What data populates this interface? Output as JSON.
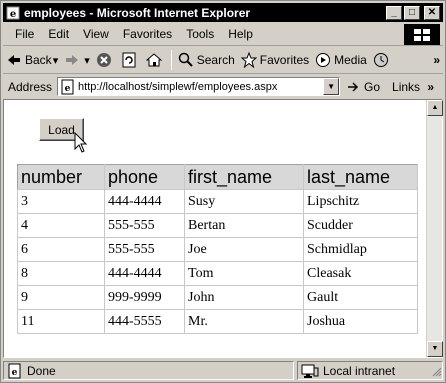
{
  "window": {
    "title": "employees - Microsoft Internet Explorer",
    "minimize_glyph": "_",
    "maximize_glyph": "□",
    "close_glyph": "✕"
  },
  "menu": [
    "File",
    "Edit",
    "View",
    "Favorites",
    "Tools",
    "Help"
  ],
  "toolbar": {
    "back_label": "Back",
    "search_label": "Search",
    "favorites_label": "Favorites",
    "media_label": "Media",
    "more_glyph": "»"
  },
  "address": {
    "label": "Address",
    "url": "http://localhost/simplewf/employees.aspx",
    "go_label": "Go",
    "links_label": "Links",
    "links_more": "»"
  },
  "page": {
    "load_button": "Load",
    "table": {
      "headers": [
        "number",
        "phone",
        "first_name",
        "last_name"
      ],
      "rows": [
        [
          "3",
          "444-4444",
          "Susy",
          "Lipschitz"
        ],
        [
          "4",
          "555-555",
          "Bertan",
          "Scudder"
        ],
        [
          "6",
          "555-555",
          "Joe",
          "Schmidlap"
        ],
        [
          "8",
          "444-4444",
          "Tom",
          "Cleasak"
        ],
        [
          "9",
          "999-9999",
          "John",
          "Gault"
        ],
        [
          "11",
          "444-5555",
          "Mr.",
          "Joshua"
        ]
      ]
    }
  },
  "status": {
    "text": "Done",
    "zone": "Local intranet"
  },
  "colors": {
    "titlebar": "#000000",
    "chrome": "#d4d0c8",
    "table_header": "#d8d8d8"
  }
}
